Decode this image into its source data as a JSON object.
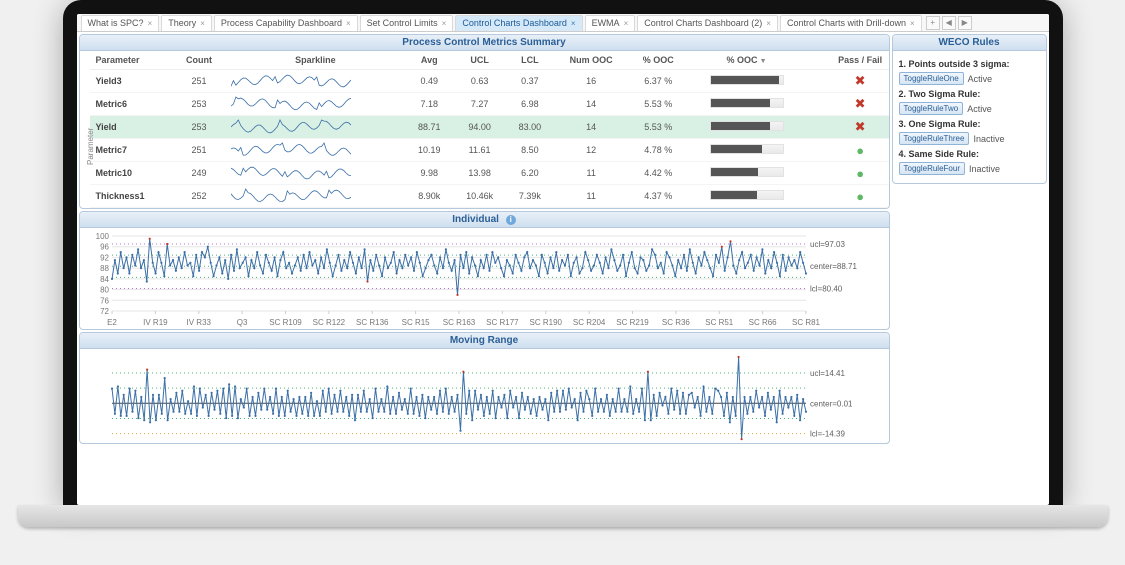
{
  "tabs": {
    "items": [
      {
        "label": "What is SPC?",
        "active": false
      },
      {
        "label": "Theory",
        "active": false
      },
      {
        "label": "Process Capability Dashboard",
        "active": false
      },
      {
        "label": "Set Control Limits",
        "active": false
      },
      {
        "label": "Control Charts Dashboard",
        "active": true
      },
      {
        "label": "EWMA",
        "active": false
      },
      {
        "label": "Control Charts Dashboard (2)",
        "active": false
      },
      {
        "label": "Control Charts with Drill-down",
        "active": false
      }
    ]
  },
  "summary": {
    "title": "Process Control Metrics Summary",
    "columns": [
      "Parameter",
      "Count",
      "Sparkline",
      "Avg",
      "UCL",
      "LCL",
      "Num OOC",
      "% OOC",
      "% OOC",
      "",
      "Pass / Fail"
    ],
    "sort_col": "% OOC",
    "parameter_axis": "Parameter",
    "rows": [
      {
        "param": "Yield3",
        "count": 251,
        "avg": "0.49",
        "ucl": "0.63",
        "lcl": "0.37",
        "num_ooc": 16,
        "pct_ooc": "6.37 %",
        "bar": 0.95,
        "pass": false
      },
      {
        "param": "Metric6",
        "count": 253,
        "avg": "7.18",
        "ucl": "7.27",
        "lcl": "6.98",
        "num_ooc": 14,
        "pct_ooc": "5.53 %",
        "bar": 0.82,
        "pass": false
      },
      {
        "param": "Yield",
        "count": 253,
        "avg": "88.71",
        "ucl": "94.00",
        "lcl": "83.00",
        "num_ooc": 14,
        "pct_ooc": "5.53 %",
        "bar": 0.82,
        "pass": false,
        "selected": true
      },
      {
        "param": "Metric7",
        "count": 251,
        "avg": "10.19",
        "ucl": "11.61",
        "lcl": "8.50",
        "num_ooc": 12,
        "pct_ooc": "4.78 %",
        "bar": 0.71,
        "pass": true
      },
      {
        "param": "Metric10",
        "count": 249,
        "avg": "9.98",
        "ucl": "13.98",
        "lcl": "6.20",
        "num_ooc": 11,
        "pct_ooc": "4.42 %",
        "bar": 0.66,
        "pass": true
      },
      {
        "param": "Thickness1",
        "count": 252,
        "avg": "8.90k",
        "ucl": "10.46k",
        "lcl": "7.39k",
        "num_ooc": 11,
        "pct_ooc": "4.37 %",
        "bar": 0.65,
        "pass": true
      }
    ]
  },
  "weco": {
    "title": "WECO Rules",
    "rules": [
      {
        "label": "1. Points outside 3 sigma:",
        "button": "ToggleRuleOne",
        "state": "Active"
      },
      {
        "label": "2. Two Sigma Rule:",
        "button": "ToggleRuleTwo",
        "state": "Active"
      },
      {
        "label": "3. One Sigma Rule:",
        "button": "ToggleRuleThree",
        "state": "Inactive"
      },
      {
        "label": "4. Same Side Rule:",
        "button": "ToggleRuleFour",
        "state": "Inactive"
      }
    ]
  },
  "individual_chart": {
    "title": "Individual",
    "y_ticks": [
      72,
      76,
      80,
      84,
      88,
      92,
      96,
      100
    ],
    "x_ticks": [
      "E2",
      "IV R19",
      "IV R33",
      "Q3",
      "SC R109",
      "SC R122",
      "SC R136",
      "SC R15",
      "SC R163",
      "SC R177",
      "SC R190",
      "SC R204",
      "SC R219",
      "SC R36",
      "SC R51",
      "SC R66",
      "SC R81"
    ],
    "refs": {
      "ucl": "ucl=97.03",
      "center": "center=88.71",
      "lcl": "lcl=80.40"
    }
  },
  "moving_range_chart": {
    "title": "Moving Range",
    "refs": {
      "ucl": "ucl=14.41",
      "center": "center=0.01",
      "lcl": "lcl=-14.39"
    }
  },
  "chart_data": {
    "individual": {
      "type": "line",
      "ylabel": "",
      "ylim": [
        72,
        100
      ],
      "ucl": 97.03,
      "center": 88.71,
      "lcl": 80.4,
      "x_categories": [
        "E2",
        "IV R19",
        "IV R33",
        "Q3",
        "SC R109",
        "SC R122",
        "SC R136",
        "SC R15",
        "SC R163",
        "SC R177",
        "SC R190",
        "SC R204",
        "SC R219",
        "SC R36",
        "SC R51",
        "SC R66",
        "SC R81"
      ],
      "values": [
        84,
        91,
        86,
        94,
        88,
        92,
        86,
        93,
        89,
        95,
        88,
        91,
        83,
        99,
        90,
        86,
        94,
        90,
        85,
        97,
        89,
        91,
        87,
        92,
        88,
        94,
        89,
        90,
        85,
        93,
        87,
        94,
        92,
        96,
        90,
        85,
        89,
        92,
        86,
        91,
        84,
        93,
        87,
        95,
        88,
        90,
        92,
        85,
        91,
        88,
        94,
        89,
        86,
        93,
        90,
        87,
        92,
        85,
        91,
        94,
        88,
        90,
        86,
        89,
        92,
        87,
        93,
        88,
        94,
        89,
        91,
        86,
        92,
        88,
        95,
        90,
        85,
        89,
        93,
        87,
        91,
        88,
        94,
        90,
        86,
        92,
        88,
        95,
        83,
        91,
        87,
        93,
        89,
        85,
        92,
        88,
        90,
        94,
        86,
        91,
        88,
        93,
        89,
        92,
        87,
        94,
        90,
        85,
        88,
        91,
        93,
        89,
        86,
        92,
        88,
        95,
        90,
        87,
        91,
        78,
        93,
        88,
        94,
        86,
        92,
        89,
        85,
        91,
        88,
        93,
        87,
        94,
        90,
        92,
        88,
        85,
        91,
        89,
        86,
        93,
        90,
        87,
        92,
        94,
        88,
        91,
        89,
        85,
        93,
        90,
        86,
        92,
        88,
        94,
        87,
        91,
        89,
        93,
        85,
        90,
        92,
        86,
        88,
        94,
        91,
        87,
        89,
        93,
        90,
        86,
        92,
        88,
        95,
        91,
        87,
        89,
        93,
        85,
        90,
        94,
        88,
        86,
        92,
        91,
        87,
        89,
        95,
        93,
        88,
        90,
        86,
        94,
        92,
        89,
        85,
        91,
        88,
        93,
        87,
        95,
        90,
        86,
        92,
        89,
        94,
        91,
        88,
        85,
        93,
        90,
        96,
        87,
        92,
        98,
        89,
        86,
        91,
        94,
        88,
        90,
        93,
        87,
        92,
        89,
        95,
        86,
        91,
        88,
        94,
        90,
        85,
        93,
        87,
        92,
        89,
        91,
        88,
        94,
        90,
        86
      ],
      "ooc_indices": [
        13,
        19,
        88,
        119,
        213,
        210
      ]
    },
    "moving_range": {
      "type": "line",
      "ylim": [
        -16,
        22
      ],
      "ucl": 14.41,
      "center": 0.01,
      "lcl": -14.39,
      "values": [
        7,
        -5,
        8,
        -6,
        4,
        -6,
        7,
        -4,
        6,
        -7,
        3,
        -8,
        16,
        -9,
        4,
        -8,
        4,
        -5,
        12,
        -8,
        2,
        -4,
        5,
        -4,
        6,
        -5,
        1,
        -5,
        8,
        -6,
        7,
        -2,
        4,
        -6,
        5,
        -3,
        6,
        -5,
        7,
        -7,
        9,
        -6,
        8,
        -7,
        2,
        -2,
        7,
        -6,
        3,
        -6,
        5,
        -3,
        7,
        -3,
        3,
        -5,
        7,
        -6,
        3,
        -6,
        6,
        -4,
        2,
        -6,
        3,
        -5,
        3,
        -6,
        5,
        -6,
        1,
        -6,
        6,
        -4,
        7,
        -5,
        4,
        -4,
        6,
        -4,
        3,
        -6,
        4,
        -8,
        4,
        -4,
        6,
        -4,
        2,
        -7,
        7,
        -4,
        2,
        -4,
        8,
        -5,
        3,
        -5,
        5,
        -3,
        2,
        -5,
        7,
        -5,
        3,
        -6,
        4,
        -7,
        3,
        -3,
        3,
        -5,
        6,
        -4,
        7,
        -5,
        3,
        -4,
        4,
        -13,
        15,
        -5,
        6,
        -8,
        6,
        -3,
        4,
        -6,
        3,
        -5,
        6,
        -7,
        3,
        -2,
        4,
        -7,
        6,
        -2,
        3,
        -7,
        5,
        -3,
        3,
        -5,
        2,
        -6,
        3,
        -3,
        2,
        -8,
        5,
        -4,
        6,
        -4,
        6,
        -3,
        7,
        -2,
        2,
        -8,
        5,
        -4,
        6,
        2,
        -6,
        7,
        -4,
        2,
        -4,
        4,
        -6,
        2,
        -4,
        7,
        -4,
        2,
        -4,
        8,
        -5,
        2,
        -4,
        7,
        -8,
        15,
        -8,
        4,
        -6,
        5,
        -1,
        3,
        -5,
        7,
        -3,
        6,
        -5,
        5,
        -5,
        4,
        5,
        -2,
        3,
        -6,
        8,
        -4,
        3,
        -5,
        7,
        6,
        3,
        -6,
        5,
        -9,
        3,
        -6,
        22,
        -17,
        3,
        -5,
        3,
        -4,
        6,
        -2,
        3,
        -6,
        5,
        -3,
        3,
        -9,
        6,
        -5,
        3,
        -2,
        3,
        -6,
        4,
        -8,
        2,
        -4
      ]
    }
  }
}
